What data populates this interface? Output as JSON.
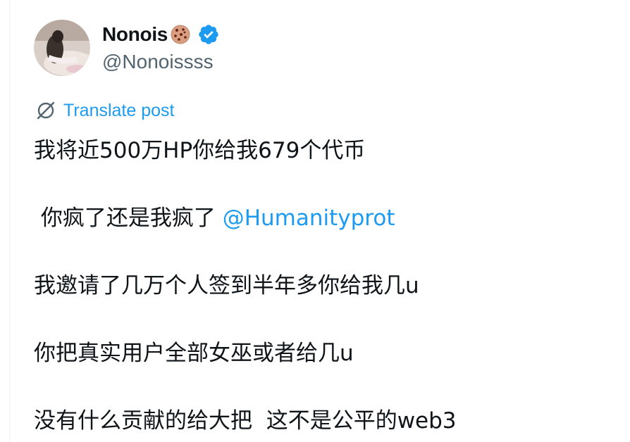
{
  "author": {
    "display_name": "Nonois",
    "emoji": "cookie-emoji",
    "verified": true,
    "handle": "@Nonoissss"
  },
  "translate": {
    "label": "Translate post",
    "icon": "translate-globe-icon"
  },
  "post": {
    "line1": "我将近500万HP你给我679个代币",
    "line2_prefix": " 你疯了还是我疯了 ",
    "line2_mention": "@Humanityprot",
    "line3": "我邀请了几万个人签到半年多你给我几u",
    "line4": "你把真实用户全部女巫或者给几u",
    "line5": "没有什么贡献的给大把  这不是公平的web3"
  },
  "colors": {
    "link": "#1d9bf0",
    "text": "#0f1419",
    "secondary": "#536471",
    "verified_badge": "#1d9bf0"
  }
}
